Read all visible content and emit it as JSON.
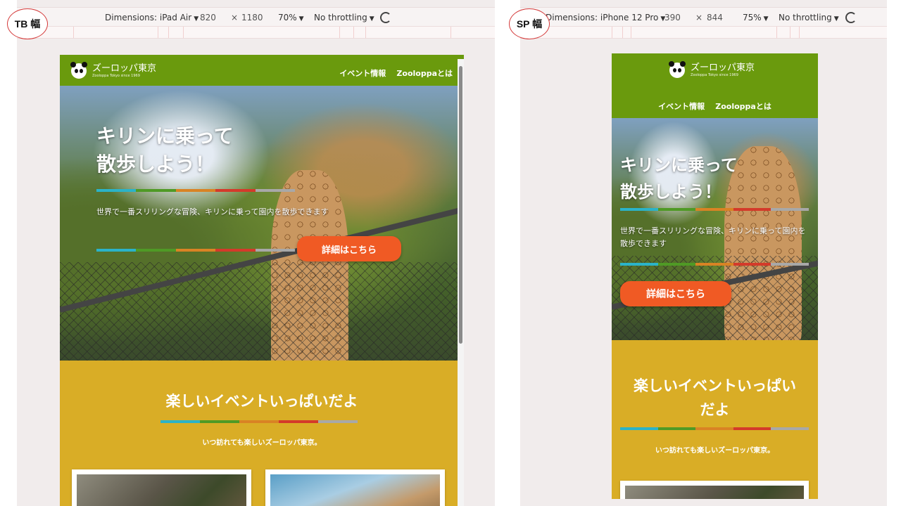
{
  "badges": {
    "tb": "TB 幅",
    "sp": "SP 幅"
  },
  "tb_devbar": {
    "dimensions_label": "Dimensions: iPad Air",
    "width": "820",
    "times": "×",
    "height": "1180",
    "zoom": "70%",
    "throttle": "No throttling"
  },
  "sp_devbar": {
    "dimensions_label": "Dimensions: iPhone 12 Pro",
    "width": "390",
    "times": "×",
    "height": "844",
    "zoom": "75%",
    "throttle": "No throttling"
  },
  "site": {
    "name": "ズーロッパ東京",
    "tagline": "Zooloppa Tokyo since 1969",
    "nav": [
      "イベント情報",
      "Zooloppaとは"
    ]
  },
  "hero": {
    "title_line1": "キリンに乗って",
    "title_line2": "散歩しよう！",
    "text": "世界で一番スリリングな冒険、キリンに乗って園内を散歩できます",
    "cta": "詳細はこちら"
  },
  "events": {
    "title": "楽しいイベントいっぱいだよ",
    "sp_title_line1": "楽しいイベントいっぱい",
    "sp_title_line2": "だよ",
    "subtitle": "いつ訪れても楽しいズーロッパ東京。"
  },
  "colors": {
    "header_green": "#6a9a0d",
    "events_yellow": "#d9ad26",
    "cta_orange": "#f05a24",
    "stripe": [
      "#2bb3c8",
      "#4f9a25",
      "#d98324",
      "#d43a2a",
      "#a8a8a8"
    ]
  }
}
